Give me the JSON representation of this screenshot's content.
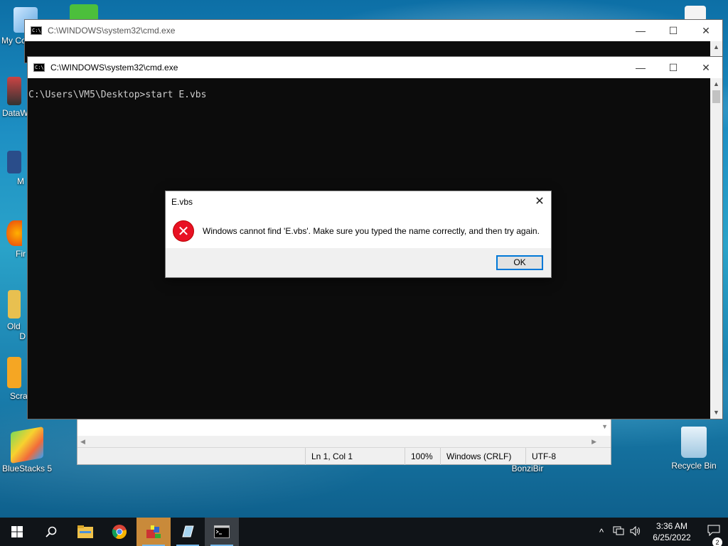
{
  "desktop": {
    "icons": [
      {
        "label": "My Co",
        "name": "my-computer"
      },
      {
        "label": "DataW",
        "name": "dataw"
      },
      {
        "label": "M",
        "name": "m-app"
      },
      {
        "label": "Fir",
        "name": "firefox"
      },
      {
        "label": "Old",
        "name": "old-folder"
      },
      {
        "label": "D",
        "name": "old-folder-line2"
      },
      {
        "label": "Scrat",
        "name": "scratch"
      },
      {
        "label": "BlueStacks 5",
        "name": "bluestacks"
      },
      {
        "label": "Recycle Bin",
        "name": "recycle-bin"
      },
      {
        "label": "BonziBir",
        "name": "bonzibir"
      }
    ]
  },
  "back_window": {
    "title": "C:\\WINDOWS\\system32\\cmd.exe"
  },
  "front_window": {
    "title": "C:\\WINDOWS\\system32\\cmd.exe",
    "console_text": "C:\\Users\\VM5\\Desktop>start E.vbs"
  },
  "window_controls": {
    "minimize": "—",
    "maximize": "☐",
    "close": "✕"
  },
  "notepad_status": {
    "position": "Ln 1, Col 1",
    "zoom": "100%",
    "line_ending": "Windows (CRLF)",
    "encoding": "UTF-8"
  },
  "dialog": {
    "title": "E.vbs",
    "message": "Windows cannot find 'E.vbs'. Make sure you typed the name correctly, and then try again.",
    "ok_label": "OK",
    "close_glyph": "✕",
    "error_glyph": "✕"
  },
  "taskbar": {
    "clock_time": "3:36 AM",
    "clock_date": "6/25/2022",
    "notification_count": "2"
  }
}
